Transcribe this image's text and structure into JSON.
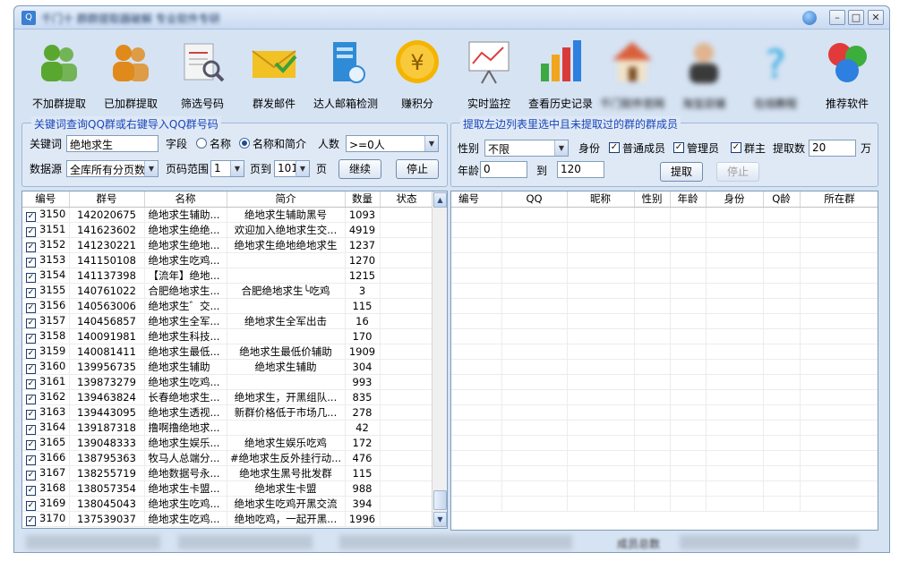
{
  "window": {
    "title": "千门十 群群提取器破解  专业软件专研",
    "controls": {
      "min": "–",
      "max": "□",
      "close": "✕"
    }
  },
  "toolbar": [
    {
      "label": "不加群提取",
      "icon": "people-icon",
      "color": "#5aa72f",
      "blurred": false
    },
    {
      "label": "已加群提取",
      "icon": "people-icon",
      "color": "#e08a1c",
      "blurred": false
    },
    {
      "label": "筛选号码",
      "icon": "search-document-icon",
      "color": "#8aa0b8",
      "blurred": false
    },
    {
      "label": "群发邮件",
      "icon": "envelope-icon",
      "color": "#f2c124",
      "blurred": false
    },
    {
      "label": "达人邮箱检测",
      "icon": "server-icon",
      "color": "#2f8bd6",
      "blurred": false
    },
    {
      "label": "赚积分",
      "icon": "coin-icon",
      "color": "#f4b400",
      "blurred": false
    },
    {
      "label": "实时监控",
      "icon": "chart-board-icon",
      "color": "#d94040",
      "blurred": false
    },
    {
      "label": "查看历史记录",
      "icon": "bar-chart-icon",
      "color": "#2d7fe0",
      "blurred": false
    },
    {
      "label": "千门软件官网",
      "icon": "house-icon",
      "color": "#d95f3c",
      "blurred": true
    },
    {
      "label": "淘宝店铺",
      "icon": "person-icon",
      "color": "#3a3a3a",
      "blurred": true
    },
    {
      "label": "在线教程",
      "icon": "help-icon",
      "color": "#29a8e0",
      "blurred": true
    },
    {
      "label": "推荐软件",
      "icon": "apps-icon",
      "color": "#e23a3a",
      "blurred": false
    }
  ],
  "left_panel": {
    "legend": "关键词查询QQ群或右键导入QQ群号码",
    "keyword_label": "关键词",
    "keyword_value": "绝地求生",
    "field_label": "字段",
    "radio_name": "名称",
    "radio_name_desc": "名称和简介",
    "people_label": "人数",
    "people_value": ">=0人",
    "source_label": "数据源",
    "source_value": "全库所有分页数",
    "page_range_label": "页码范围",
    "page_from": "1",
    "page_to_label": "页到",
    "page_to": "101",
    "page_unit": "页",
    "continue_button": "继续",
    "stop_button": "停止"
  },
  "right_panel": {
    "legend": "提取左边列表里选中且未提取过的群的群成员",
    "gender_label": "性别",
    "gender_value": "不限",
    "role_label": "身份",
    "role_normal": "普通成员",
    "role_admin": "管理员",
    "role_owner": "群主",
    "count_label": "提取数",
    "count_value": "20",
    "count_unit": "万",
    "age_label": "年龄",
    "age_from": "0",
    "age_to_label": "到",
    "age_to": "120",
    "extract_button": "提取",
    "stop_button": "停止"
  },
  "group_table": {
    "headers": [
      "编号",
      "群号",
      "名称",
      "简介",
      "数量",
      "状态"
    ],
    "rows": [
      [
        "3150",
        "142020675",
        "绝地求生辅助...",
        "绝地求生辅助黑号",
        "1093",
        ""
      ],
      [
        "3151",
        "141623602",
        "绝地求生绝绝...",
        "欢迎加入绝地求生交...",
        "4919",
        ""
      ],
      [
        "3152",
        "141230221",
        "绝地求生绝地...",
        "绝地求生绝地绝地求生",
        "1237",
        ""
      ],
      [
        "3153",
        "141150108",
        "绝地求生吃鸡...",
        "",
        "1270",
        ""
      ],
      [
        "3154",
        "141137398",
        "【流年】绝地...",
        "",
        "1215",
        ""
      ],
      [
        "3155",
        "140761022",
        "合肥绝地求生...",
        "合肥绝地求生╰吃鸡",
        "3",
        ""
      ],
      [
        "3156",
        "140563006",
        "绝地求生゛交...",
        "",
        "115",
        ""
      ],
      [
        "3157",
        "140456857",
        "绝地求生全军...",
        "绝地求生全军出击",
        "16",
        ""
      ],
      [
        "3158",
        "140091981",
        "绝地求生科技...",
        "",
        "170",
        ""
      ],
      [
        "3159",
        "140081411",
        "绝地求生最低...",
        "绝地求生最低价辅助",
        "1909",
        ""
      ],
      [
        "3160",
        "139956735",
        "绝地求生辅助",
        "绝地求生辅助",
        "304",
        ""
      ],
      [
        "3161",
        "139873279",
        "绝地求生吃鸡...",
        "",
        "993",
        ""
      ],
      [
        "3162",
        "139463824",
        "长春绝地求生...",
        "绝地求生，开黑组队...",
        "835",
        ""
      ],
      [
        "3163",
        "139443095",
        "绝地求生透视...",
        "新群价格低于市场几...",
        "278",
        ""
      ],
      [
        "3164",
        "139187318",
        "撸啊撸绝地求...",
        "",
        "42",
        ""
      ],
      [
        "3165",
        "139048333",
        "绝地求生娱乐...",
        "绝地求生娱乐吃鸡",
        "172",
        ""
      ],
      [
        "3166",
        "138795363",
        "牧马人总端分...",
        "#绝地求生反外挂行动...",
        "476",
        ""
      ],
      [
        "3167",
        "138255719",
        "绝地数据号永...",
        "绝地求生黑号批发群",
        "115",
        ""
      ],
      [
        "3168",
        "138057354",
        "绝地求生卡盟...",
        "绝地求生卡盟",
        "988",
        ""
      ],
      [
        "3169",
        "138045043",
        "绝地求生吃鸡...",
        "绝地求生吃鸡开黑交流",
        "394",
        ""
      ],
      [
        "3170",
        "137539037",
        "绝地求生吃鸡...",
        "绝地吃鸡，一起开黑...",
        "1996",
        ""
      ]
    ]
  },
  "member_table": {
    "headers": [
      "编号",
      "QQ",
      "昵称",
      "性别",
      "年龄",
      "身份",
      "Q龄",
      "所在群"
    ]
  },
  "statusbar": {
    "members_label": "成员总数"
  }
}
